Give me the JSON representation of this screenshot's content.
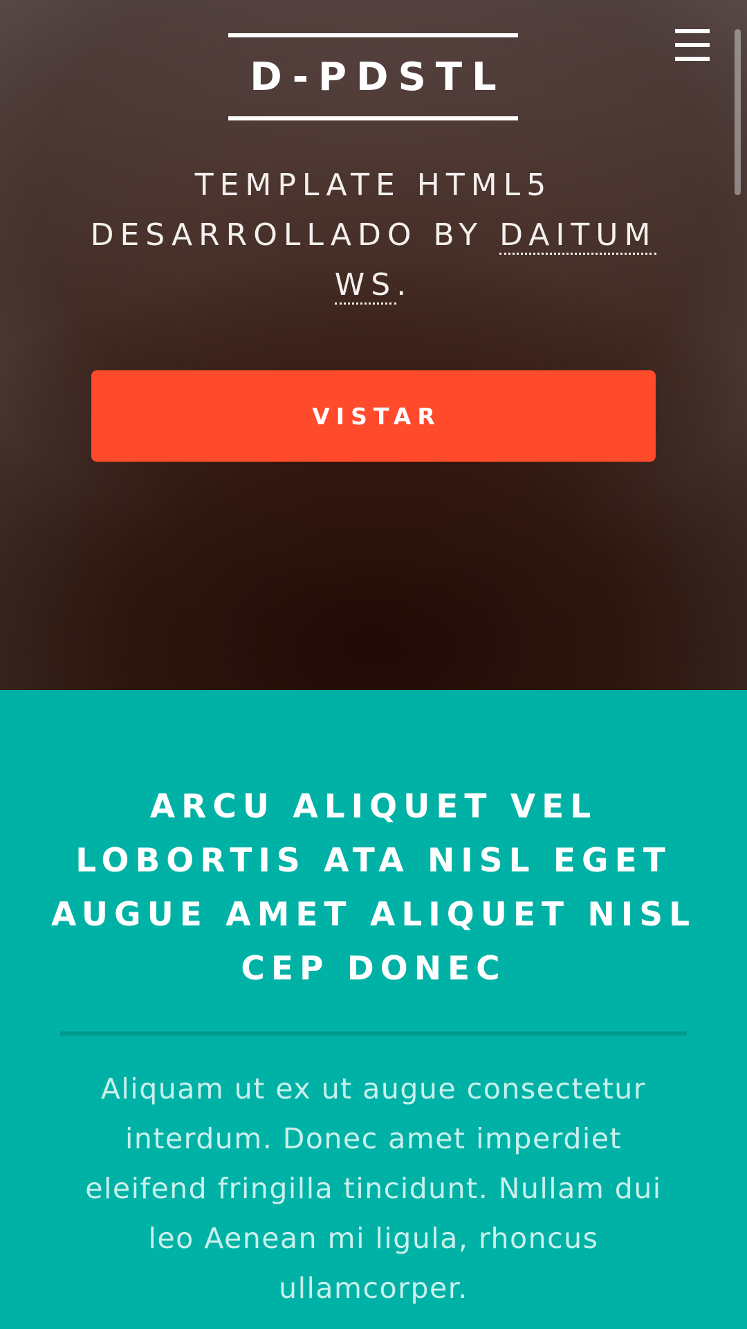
{
  "header": {
    "logo": "D-PDSTL",
    "menu_icon": "hamburger-menu-icon",
    "tagline_prefix": "TEMPLATE HTML5 DESARROLLADO BY ",
    "tagline_link_part1": "DAITUM",
    "tagline_link_part2": "WS",
    "tagline_suffix": ".",
    "cta_label": "VISTAR"
  },
  "section": {
    "title": "ARCU ALIQUET VEL LOBORTIS ATA NISL EGET AUGUE AMET ALIQUET NISL CEP DONEC",
    "body": "Aliquam ut ex ut augue consectetur interdum. Donec amet imperdiet eleifend fringilla tincidunt. Nullam dui leo Aenean mi ligula, rhoncus ullamcorper."
  },
  "colors": {
    "accent": "#ff4a2c",
    "teal": "#00b2a6",
    "divider": "#00998f",
    "body_text": "#c9f0ec"
  }
}
